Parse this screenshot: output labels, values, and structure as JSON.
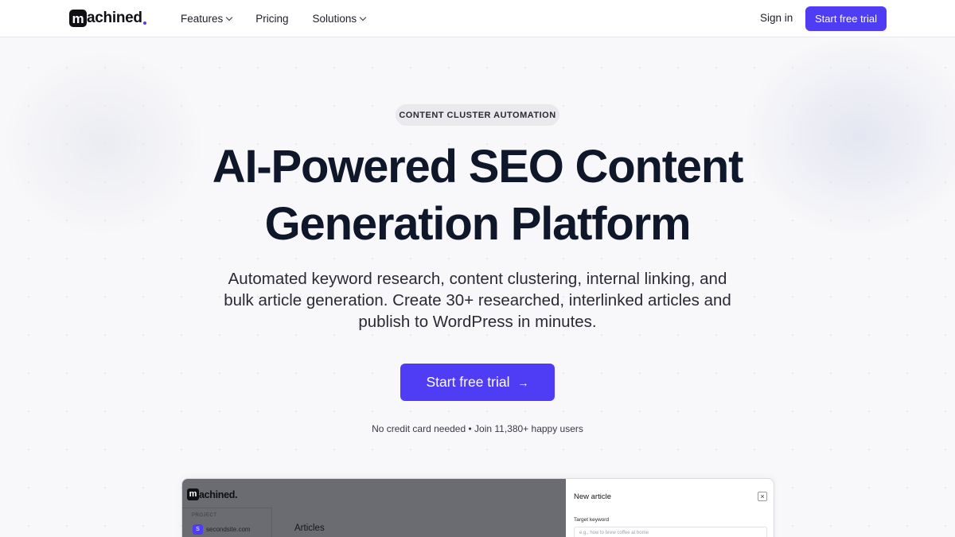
{
  "header": {
    "logo_initial": "m",
    "logo_rest": "achined",
    "nav": [
      {
        "label": "Features",
        "has_dropdown": true
      },
      {
        "label": "Pricing",
        "has_dropdown": false
      },
      {
        "label": "Solutions",
        "has_dropdown": true
      }
    ],
    "sign_in": "Sign in",
    "cta": "Start free trial"
  },
  "hero": {
    "badge": "CONTENT CLUSTER AUTOMATION",
    "title_line1": "AI-Powered SEO Content",
    "title_line2": "Generation Platform",
    "subtitle": "Automated keyword research, content clustering, internal linking, and bulk article generation. Create 30+ researched, interlinked articles and publish to WordPress in minutes.",
    "cta": "Start free trial",
    "cta_icon": "arrow-right-icon",
    "note": "No credit card needed • Join 11,380+ happy users"
  },
  "preview": {
    "logo_initial": "m",
    "logo_rest": "achined.",
    "project_label": "PROJECT",
    "site_icon": "S",
    "site": "secondsite.com",
    "articles_heading": "Articles",
    "panel_title": "New article",
    "close_icon": "×",
    "target_keyword_label": "Target keyword",
    "target_keyword_placeholder": "e.g., how to brew coffee at home"
  },
  "colors": {
    "accent": "#4f3df5",
    "text": "#0f172a",
    "background": "#f8f8fa"
  }
}
